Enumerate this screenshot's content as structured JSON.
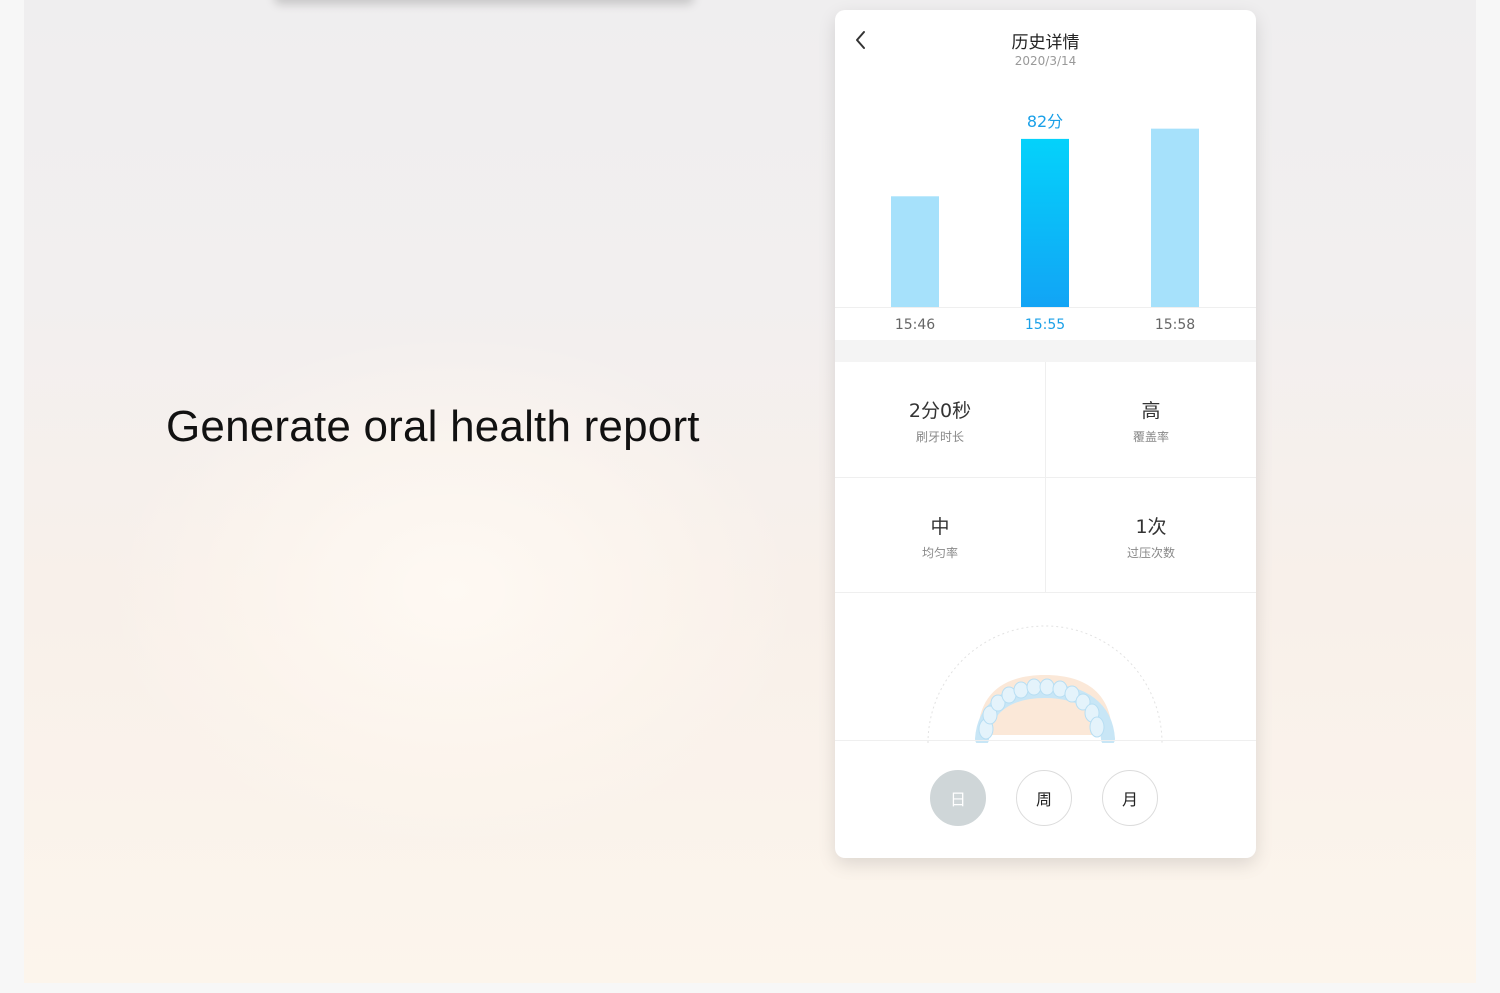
{
  "caption": "Generate oral health report",
  "header": {
    "title": "历史详情",
    "date": "2020/3/14",
    "back_icon": "chevron-left-icon"
  },
  "chart_data": {
    "type": "bar",
    "categories": [
      "15:46",
      "15:55",
      "15:58"
    ],
    "values": [
      54,
      82,
      87
    ],
    "selected_index": 1,
    "selected_label": "82分",
    "colors": {
      "normal": "#a6e1fb",
      "selected_top": "#04d2fb",
      "selected_bottom": "#12a4f5",
      "selected_text": "#1aa0e8",
      "tick": "#666666"
    }
  },
  "stats": [
    {
      "value": "2分0秒",
      "label": "刷牙时长"
    },
    {
      "value": "高",
      "label": "覆盖率"
    },
    {
      "value": "中",
      "label": "均匀率"
    },
    {
      "value": "1次",
      "label": "过压次数"
    }
  ],
  "periods": [
    {
      "label": "日",
      "active": true
    },
    {
      "label": "周",
      "active": false
    },
    {
      "label": "月",
      "active": false
    }
  ]
}
